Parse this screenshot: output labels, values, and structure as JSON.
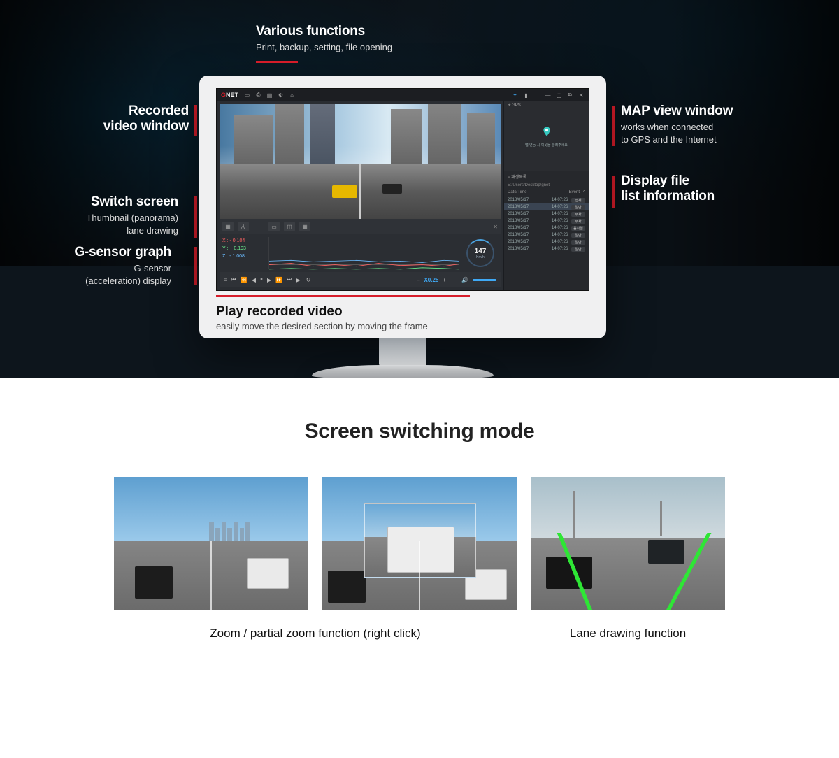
{
  "top": {
    "various": {
      "title": "Various functions",
      "sub": "Print, backup, setting, file opening"
    },
    "recorded": {
      "title": "Recorded\nvideo window"
    },
    "switch": {
      "title": "Switch screen",
      "sub": "Thumbnail (panorama)\nlane drawing"
    },
    "gsensor": {
      "title": "G-sensor graph",
      "sub": "G-sensor\n(acceleration) display"
    },
    "map": {
      "title": "MAP view window",
      "sub": "works when connected\nto GPS and the Internet"
    },
    "filelist": {
      "title": "Display file\nlist information"
    },
    "play": {
      "title": "Play recorded video",
      "sub": "easily move the desired section by moving the frame"
    }
  },
  "app": {
    "logo": {
      "g": "G",
      "net": "NET"
    },
    "gpsLabel": "GPS",
    "mapHint": "맵 연동 시 이곳을 눌러주세요",
    "listHeader": "재생목록",
    "path": "E:/Users/Desktop/gnet",
    "colDate": "Date/Time",
    "colEvent": "Event",
    "speed": "147",
    "speedUnit": "Km/h",
    "playSpeed": "X0.25",
    "axes": {
      "x": "X : - 0.104",
      "y": "Y : + 0.193",
      "z": "Z : - 1.008"
    },
    "rows": [
      {
        "d": "2018/05/17",
        "t": "14:07:26",
        "e": "전체"
      },
      {
        "d": "2018/05/17",
        "t": "14:07:26",
        "e": "일반",
        "sel": true
      },
      {
        "d": "2018/05/17",
        "t": "14:07:26",
        "e": "주차"
      },
      {
        "d": "2018/05/17",
        "t": "14:07:26",
        "e": "주차"
      },
      {
        "d": "2018/05/17",
        "t": "14:07:26",
        "e": "움직임"
      },
      {
        "d": "2018/05/17",
        "t": "14:07:26",
        "e": "일반"
      },
      {
        "d": "2018/05/17",
        "t": "14:07:26",
        "e": "일반"
      },
      {
        "d": "2018/05/17",
        "t": "14:07:26",
        "e": "일반"
      }
    ]
  },
  "lower": {
    "heading": "Screen switching mode",
    "cap1": "Zoom / partial zoom function (right click)",
    "cap2": "Lane drawing function"
  }
}
